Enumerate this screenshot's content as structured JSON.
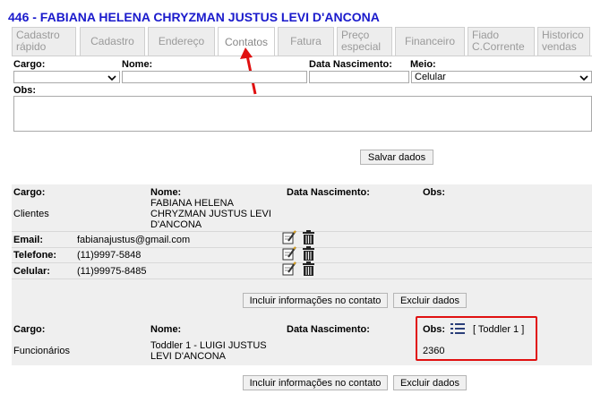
{
  "header": {
    "title": "446 - FABIANA HELENA CHRYZMAN JUSTUS LEVI D'ANCONA"
  },
  "tabs": [
    {
      "line1": "Cadastro",
      "line2": "rápido"
    },
    {
      "line1": "Cadastro",
      "line2": ""
    },
    {
      "line1": "Endereço",
      "line2": ""
    },
    {
      "line1": "Contatos",
      "line2": ""
    },
    {
      "line1": "Fatura",
      "line2": ""
    },
    {
      "line1": "Preço",
      "line2": "especial"
    },
    {
      "line1": "Financeiro",
      "line2": ""
    },
    {
      "line1": "Fiado",
      "line2": "C.Corrente"
    },
    {
      "line1": "Historico",
      "line2": "vendas"
    }
  ],
  "form": {
    "cargo_label": "Cargo:",
    "nome_label": "Nome:",
    "nasc_label": "Data Nascimento:",
    "meio_label": "Meio:",
    "meio_value": "Celular",
    "obs_label": "Obs:",
    "save_label": "Salvar dados"
  },
  "contact1": {
    "cargo_label": "Cargo:",
    "nome_label": "Nome:",
    "nasc_label": "Data Nascimento:",
    "obs_label": "Obs:",
    "cargo": "Clientes",
    "nome_line1": "FABIANA HELENA",
    "nome_line2": "CHRYZMAN JUSTUS LEVI",
    "nome_line3": "D'ANCONA",
    "email_label": "Email:",
    "email": "fabianajustus@gmail.com",
    "tel_label": "Telefone:",
    "tel": "(11)9997-5848",
    "cel_label": "Celular:",
    "cel": "(11)99975-8485",
    "include_label": "Incluir informações no contato",
    "delete_label": "Excluir dados"
  },
  "contact2": {
    "cargo_label": "Cargo:",
    "nome_label": "Nome:",
    "nasc_label": "Data Nascimento:",
    "obs_label": "Obs:",
    "obs_link": "[ Toddler 1 ]",
    "obs_value": "2360",
    "cargo": "Funcionários",
    "nome_line1": "Toddler 1 - LUIGI JUSTUS",
    "nome_line2": "LEVI D'ANCONA",
    "include_label": "Incluir informações no contato",
    "delete_label": "Excluir dados"
  },
  "icons": [
    "edit-icon",
    "trash-icon",
    "list-icon",
    "chevron-down-icon",
    "red-arrow-icon"
  ],
  "colors": {
    "title": "#1a1acc",
    "highlight": "#e01010",
    "block_bg": "#efefef"
  }
}
